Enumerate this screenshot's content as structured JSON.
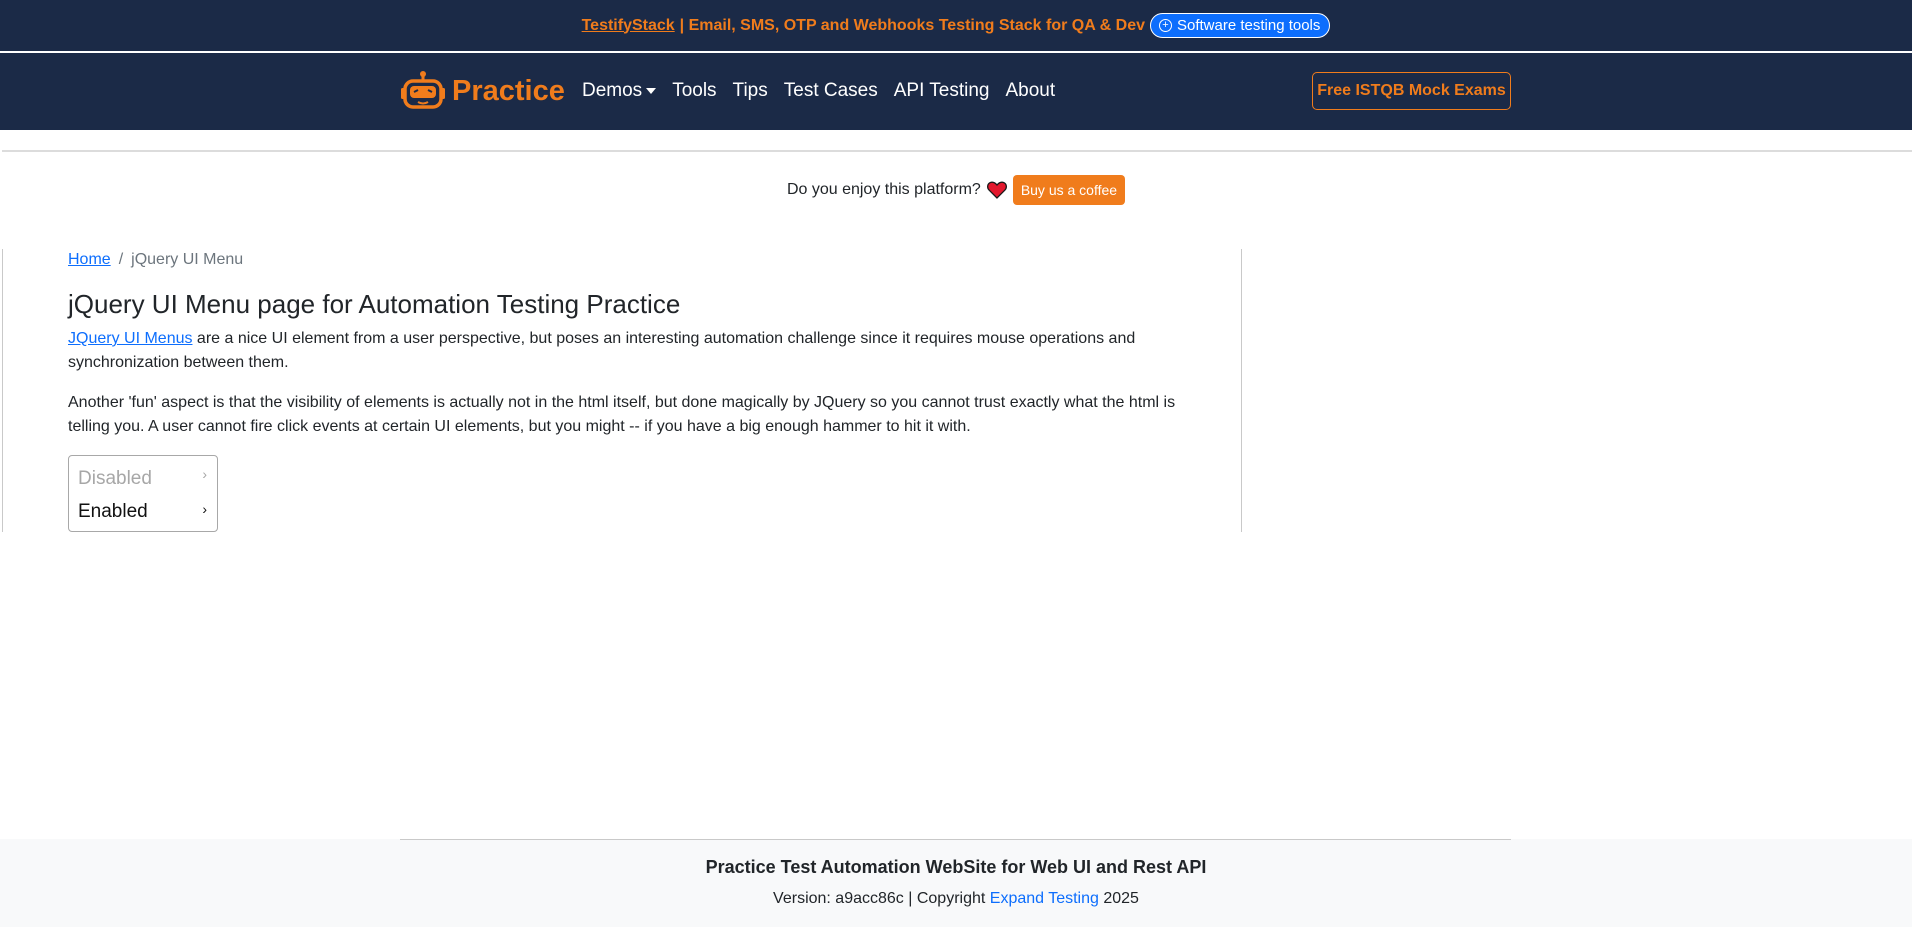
{
  "promo": {
    "brand": "TestifyStack",
    "tagline": "| Email, SMS, OTP and Webhooks Testing Stack for QA & Dev",
    "pill_label": "Software testing tools"
  },
  "navbar": {
    "brand": "Practice",
    "links": [
      "Demos",
      "Tools",
      "Tips",
      "Test Cases",
      "API Testing",
      "About"
    ],
    "cta": "Free ISTQB Mock Exams"
  },
  "coffee": {
    "question": "Do you enjoy this platform?",
    "button": "Buy us a coffee"
  },
  "breadcrumb": {
    "home": "Home",
    "separator": "/",
    "current": "jQuery UI Menu"
  },
  "main": {
    "title": "jQuery UI Menu page for Automation Testing Practice",
    "para1_link": "JQuery UI Menus",
    "para1_rest": " are a nice UI element from a user perspective, but poses an interesting automation challenge since it requires mouse operations and synchronization between them.",
    "para2": "Another 'fun' aspect is that the visibility of elements is actually not in the html itself, but done magically by JQuery so you cannot trust exactly what the html is telling you. A user cannot fire click events at certain UI elements, but you might -- if you have a big enough hammer to hit it with."
  },
  "menu": {
    "items": [
      {
        "label": "Disabled",
        "state": "disabled"
      },
      {
        "label": "Enabled",
        "state": "enabled"
      }
    ]
  },
  "footer": {
    "title": "Practice Test Automation WebSite for Web UI and Rest API",
    "version_prefix": "Version: a9acc86c | Copyright",
    "link": "Expand Testing",
    "year": "2025"
  },
  "colors": {
    "navy": "#1b2a47",
    "accent_orange": "#f07c1c",
    "link_blue": "#0d6efd"
  }
}
